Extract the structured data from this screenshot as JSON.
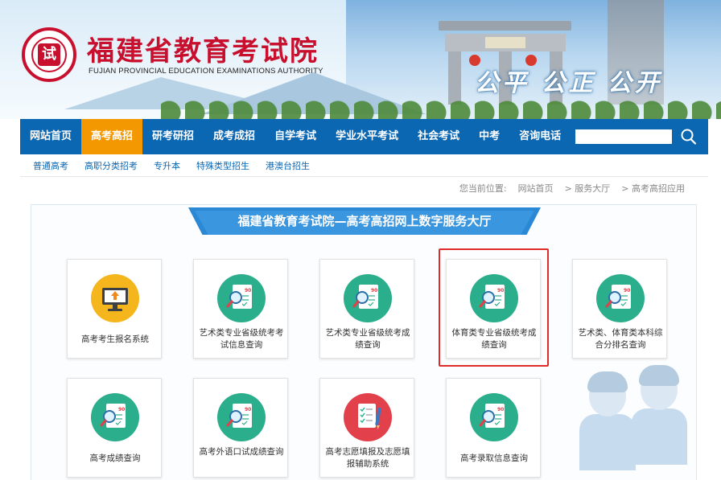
{
  "header": {
    "title": "福建省教育考试院",
    "title_en": "FUJIAN PROVINCIAL EDUCATION EXAMINATIONS AUTHORITY",
    "slogan": "公平 公正 公开",
    "logo_icon": "seal-logo-icon"
  },
  "nav": {
    "items": [
      {
        "label": "网站首页",
        "active": false
      },
      {
        "label": "高考高招",
        "active": true
      },
      {
        "label": "研考研招",
        "active": false
      },
      {
        "label": "成考成招",
        "active": false
      },
      {
        "label": "自学考试",
        "active": false
      },
      {
        "label": "学业水平考试",
        "active": false
      },
      {
        "label": "社会考试",
        "active": false
      },
      {
        "label": "中考",
        "active": false
      },
      {
        "label": "咨询电话",
        "active": false
      }
    ],
    "search": {
      "value": "",
      "placeholder": ""
    },
    "search_icon": "search-icon",
    "active_color": "#f39800",
    "bar_color": "#0c67b2"
  },
  "subnav": {
    "items": [
      "普通高考",
      "高职分类招考",
      "专升本",
      "特殊类型招生",
      "港澳台招生"
    ]
  },
  "breadcrumb": {
    "prefix": "您当前位置:",
    "items": [
      "网站首页",
      "> 服务大厅",
      "> 高考高招应用"
    ]
  },
  "main": {
    "banner_title": "福建省教育考试院—高考高招网上数字服务大厅",
    "cards": [
      {
        "label": "高考考生报名系统",
        "icon": "computer-upload-icon"
      },
      {
        "label": "艺术类专业省级统考考试信息查询",
        "icon": "score-report-search-icon"
      },
      {
        "label": "艺术类专业省级统考成绩查询",
        "icon": "score-report-search-icon"
      },
      {
        "label": "体育类专业省级统考成绩查询",
        "icon": "score-report-search-icon",
        "highlighted": true
      },
      {
        "label": "艺术类、体育类本科综合分排名查询",
        "icon": "score-report-search-icon"
      },
      {
        "label": "高考成绩查询",
        "icon": "score-report-search-icon"
      },
      {
        "label": "高考外语口试成绩查询",
        "icon": "score-report-search-icon"
      },
      {
        "label": "高考志愿填报及志愿填报辅助系统",
        "icon": "checklist-pencil-icon"
      },
      {
        "label": "高考录取信息查询",
        "icon": "score-report-search-icon"
      }
    ],
    "highlight_color": "#e02b2b"
  }
}
